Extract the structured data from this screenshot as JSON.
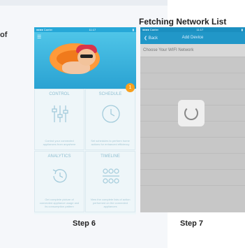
{
  "background": {
    "fragment_text": "of"
  },
  "heading": "Fetching Network List",
  "step6": {
    "caption": "Step 6",
    "status_bar": {
      "carrier": "●●●● Carrier",
      "time": "11:17"
    },
    "badge_count": "1",
    "tiles": [
      {
        "title": "CONTROL",
        "desc": "Control your connected appliances from anywhere",
        "icon": "sliders-icon"
      },
      {
        "title": "SCHEDULE",
        "desc": "Set schedules to perform home actions for enhanced efficiency",
        "icon": "clock-icon"
      },
      {
        "title": "ANALYTICS",
        "desc": "Get complete picture of connected appliance usage and its consumption pattern",
        "icon": "history-icon"
      },
      {
        "title": "TIMELINE",
        "desc": "View the complete lists of action performed on the connected appliances",
        "icon": "timeline-icon"
      }
    ]
  },
  "step7": {
    "caption": "Step 7",
    "status_bar": {
      "carrier": "●●●● Carrier",
      "time": "11:17"
    },
    "nav": {
      "back": "❮ Back",
      "title": "Add Device"
    },
    "wifi_prompt": "Choose Your WIFI Network"
  },
  "colors": {
    "accent": "#2197c8",
    "badge": "#f7a01e",
    "ring": "#f07a1c"
  }
}
